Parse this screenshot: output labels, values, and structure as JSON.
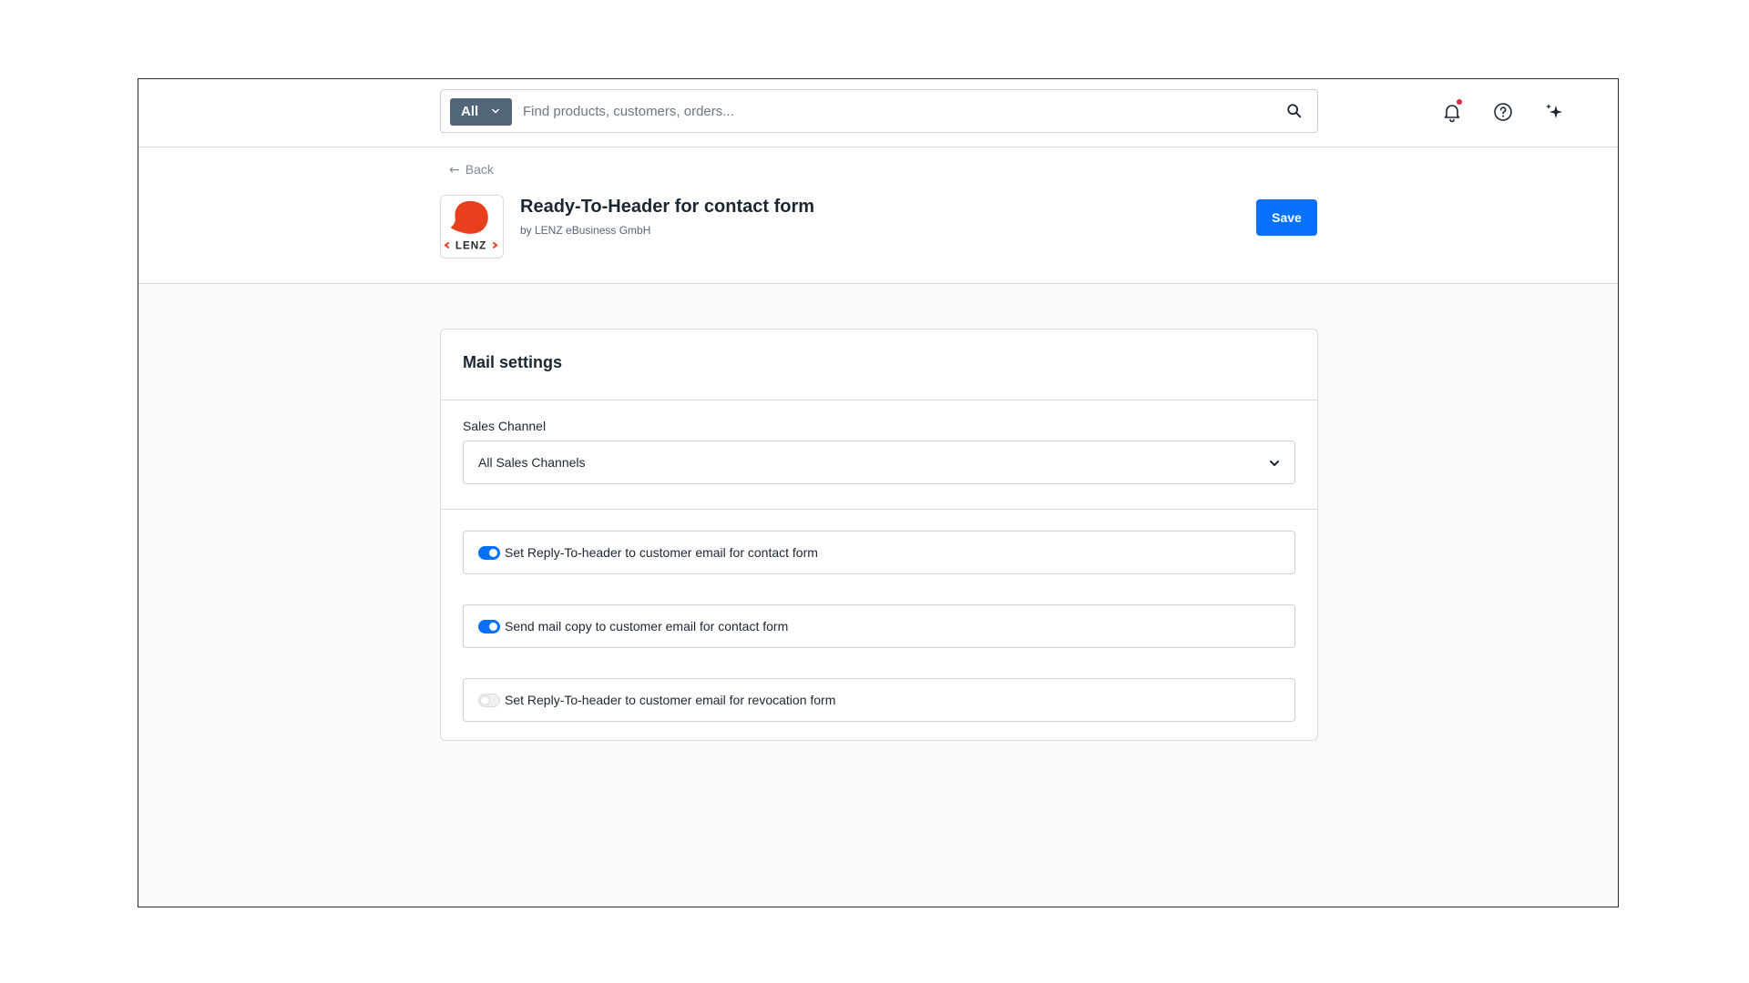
{
  "search": {
    "type_label": "All",
    "placeholder": "Find products, customers, orders..."
  },
  "topbar": {
    "icons": [
      "bell-icon",
      "help-icon",
      "sparkles-icon"
    ],
    "notification_dot_color": "#de294c"
  },
  "header": {
    "back_label": "Back",
    "app_title": "Ready-To-Header for contact form",
    "vendor": "by LENZ eBusiness GmbH",
    "logo_text": "LENZ",
    "save_label": "Save"
  },
  "card": {
    "title": "Mail settings",
    "sales_channel": {
      "label": "Sales Channel",
      "value": "All Sales Channels"
    },
    "toggles": [
      {
        "label": "Set Reply-To-header to customer email for contact form",
        "checked": true
      },
      {
        "label": "Send mail copy to customer email for contact form",
        "checked": true
      },
      {
        "label": "Set Reply-To-header to customer email for revocation form",
        "checked": false
      }
    ]
  },
  "colors": {
    "accent": "#0870ff",
    "logo_red": "#e8401c",
    "search_type_bg": "#52667a"
  }
}
